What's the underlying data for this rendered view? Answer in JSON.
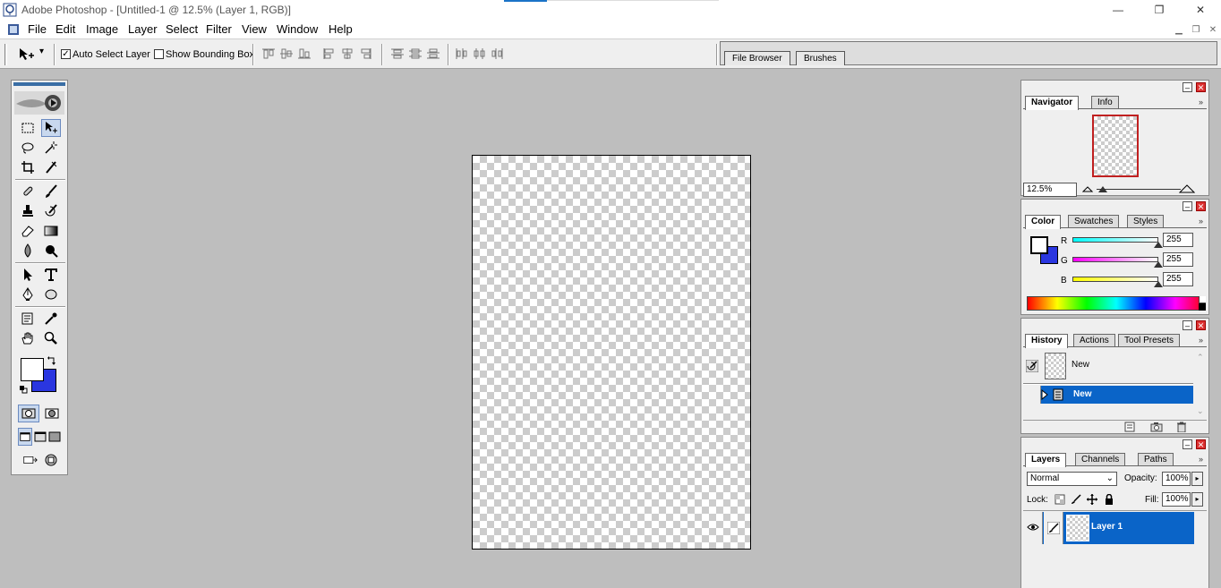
{
  "window": {
    "title": "Adobe Photoshop - [Untitled-1 @ 12.5% (Layer 1, RGB)]",
    "minimize": "—",
    "restore": "❐",
    "close": "✕"
  },
  "menu": {
    "items": [
      "File",
      "Edit",
      "Image",
      "Layer",
      "Select",
      "Filter",
      "View",
      "Window",
      "Help"
    ]
  },
  "options": {
    "auto_select_layer": "Auto Select Layer",
    "auto_select_checked": "✓",
    "show_bounding_box": "Show Bounding Box",
    "tool_dropdown": "▾"
  },
  "palette_well": {
    "tabs": [
      "File Browser",
      "Brushes"
    ]
  },
  "toolbox": {
    "foreground_color": "#ffffff",
    "background_color": "#2a36e0"
  },
  "navigator": {
    "tabs": [
      "Navigator",
      "Info"
    ],
    "zoom": "12.5%"
  },
  "color": {
    "tabs": [
      "Color",
      "Swatches",
      "Styles"
    ],
    "channels": [
      {
        "label": "R",
        "value": "255"
      },
      {
        "label": "G",
        "value": "255"
      },
      {
        "label": "B",
        "value": "255"
      }
    ]
  },
  "history": {
    "tabs": [
      "History",
      "Actions",
      "Tool Presets"
    ],
    "snapshot_label": "New",
    "state_label": "New"
  },
  "layers": {
    "tabs": [
      "Layers",
      "Channels",
      "Paths"
    ],
    "blend_mode": "Normal",
    "opacity_label": "Opacity:",
    "opacity_value": "100%",
    "lock_label": "Lock:",
    "fill_label": "Fill:",
    "fill_value": "100%",
    "layer_name": "Layer 1"
  },
  "colors": {
    "selection_blue": "#0a64c8",
    "panel_bg": "#efefef",
    "workspace_bg": "#bebebe"
  }
}
